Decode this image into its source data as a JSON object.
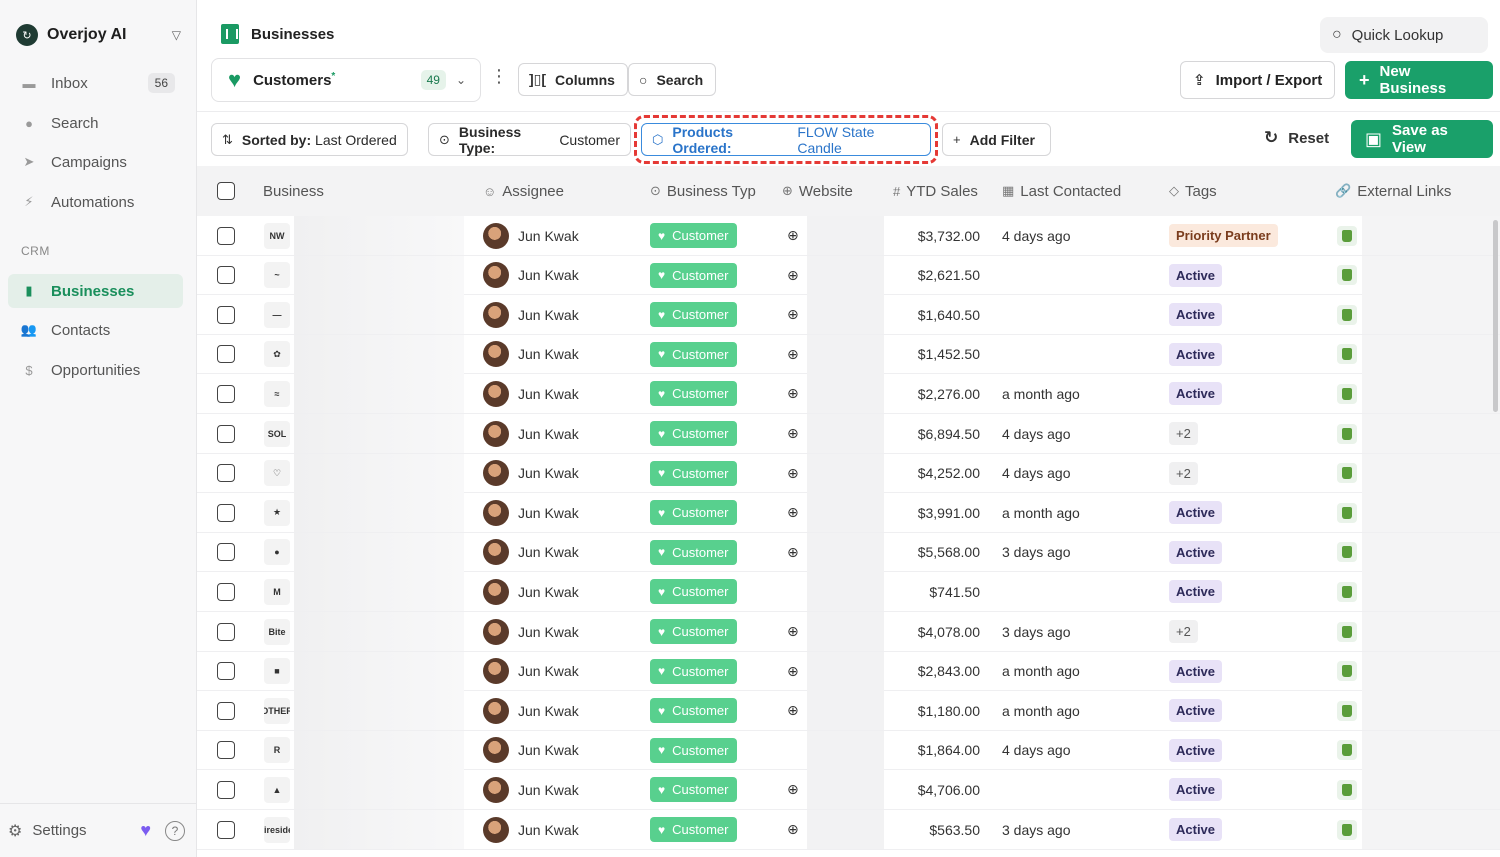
{
  "sidebar": {
    "brand": "Overjoy AI",
    "items": [
      {
        "label": "Inbox",
        "count": "56",
        "icon": "inbox-icon"
      },
      {
        "label": "Search",
        "icon": "search-icon"
      },
      {
        "label": "Campaigns",
        "icon": "send-icon"
      },
      {
        "label": "Automations",
        "icon": "bolt-icon"
      }
    ],
    "section": "CRM",
    "crm_items": [
      {
        "label": "Businesses",
        "icon": "building-icon",
        "active": true
      },
      {
        "label": "Contacts",
        "icon": "people-icon"
      },
      {
        "label": "Opportunities",
        "icon": "dollar-icon"
      }
    ],
    "settings": "Settings"
  },
  "header": {
    "title": "Businesses",
    "quick_lookup": "Quick Lookup",
    "view_name": "Customers",
    "view_count": "49",
    "columns_btn": "Columns",
    "search_btn": "Search",
    "import_export": "Import / Export",
    "new_business": "New Business"
  },
  "filters": {
    "sorted_label": "Sorted by:",
    "sorted_value": "Last Ordered",
    "type_label": "Business Type:",
    "type_value": "Customer",
    "products_label": "Products Ordered:",
    "products_value": "FLOW State Candle",
    "add_filter": "Add Filter",
    "reset": "Reset",
    "save_view": "Save as View"
  },
  "table": {
    "columns": [
      "Business",
      "Assignee",
      "Business Typ",
      "Website",
      "YTD Sales",
      "Last Contacted",
      "Tags",
      "External Links"
    ],
    "rows": [
      {
        "logo": "NW",
        "assignee": "Jun Kwak",
        "type": "Customer",
        "web": true,
        "sales": "$3,732.00",
        "contacted": "4 days ago",
        "tag": "Priority Partner",
        "tag_kind": "priority"
      },
      {
        "logo": "~",
        "assignee": "Jun Kwak",
        "type": "Customer",
        "web": true,
        "sales": "$2,621.50",
        "contacted": "",
        "tag": "Active",
        "tag_kind": "active"
      },
      {
        "logo": "—",
        "assignee": "Jun Kwak",
        "type": "Customer",
        "web": true,
        "sales": "$1,640.50",
        "contacted": "",
        "tag": "Active",
        "tag_kind": "active"
      },
      {
        "logo": "✿",
        "assignee": "Jun Kwak",
        "type": "Customer",
        "web": true,
        "sales": "$1,452.50",
        "contacted": "",
        "tag": "Active",
        "tag_kind": "active"
      },
      {
        "logo": "≈",
        "assignee": "Jun Kwak",
        "type": "Customer",
        "web": true,
        "sales": "$2,276.00",
        "contacted": "a month ago",
        "tag": "Active",
        "tag_kind": "active"
      },
      {
        "logo": "SOL",
        "assignee": "Jun Kwak",
        "type": "Customer",
        "web": true,
        "sales": "$6,894.50",
        "contacted": "4 days ago",
        "tag": "+2",
        "tag_kind": "more"
      },
      {
        "logo": "♡",
        "assignee": "Jun Kwak",
        "type": "Customer",
        "web": true,
        "sales": "$4,252.00",
        "contacted": "4 days ago",
        "tag": "+2",
        "tag_kind": "more"
      },
      {
        "logo": "★",
        "assignee": "Jun Kwak",
        "type": "Customer",
        "web": true,
        "sales": "$3,991.00",
        "contacted": "a month ago",
        "tag": "Active",
        "tag_kind": "active"
      },
      {
        "logo": "●",
        "assignee": "Jun Kwak",
        "type": "Customer",
        "web": true,
        "sales": "$5,568.00",
        "contacted": "3 days ago",
        "tag": "Active",
        "tag_kind": "active"
      },
      {
        "logo": "M",
        "assignee": "Jun Kwak",
        "type": "Customer",
        "web": false,
        "sales": "$741.50",
        "contacted": "",
        "tag": "Active",
        "tag_kind": "active"
      },
      {
        "logo": "Bite",
        "assignee": "Jun Kwak",
        "type": "Customer",
        "web": true,
        "sales": "$4,078.00",
        "contacted": "3 days ago",
        "tag": "+2",
        "tag_kind": "more"
      },
      {
        "logo": "■",
        "assignee": "Jun Kwak",
        "type": "Customer",
        "web": true,
        "sales": "$2,843.00",
        "contacted": "a month ago",
        "tag": "Active",
        "tag_kind": "active"
      },
      {
        "logo": "OTHER",
        "assignee": "Jun Kwak",
        "type": "Customer",
        "web": true,
        "sales": "$1,180.00",
        "contacted": "a month ago",
        "tag": "Active",
        "tag_kind": "active"
      },
      {
        "logo": "R",
        "assignee": "Jun Kwak",
        "type": "Customer",
        "web": false,
        "sales": "$1,864.00",
        "contacted": "4 days ago",
        "tag": "Active",
        "tag_kind": "active"
      },
      {
        "logo": "▲",
        "assignee": "Jun Kwak",
        "type": "Customer",
        "web": true,
        "sales": "$4,706.00",
        "contacted": "",
        "tag": "Active",
        "tag_kind": "active"
      },
      {
        "logo": "fireside",
        "assignee": "Jun Kwak",
        "type": "Customer",
        "web": true,
        "sales": "$563.50",
        "contacted": "3 days ago",
        "tag": "Active",
        "tag_kind": "active"
      }
    ]
  },
  "colors": {
    "accent": "#1aa06a",
    "badge": "#58d08e",
    "highlight": "#e53935",
    "filter_blue": "#2a74c9"
  }
}
